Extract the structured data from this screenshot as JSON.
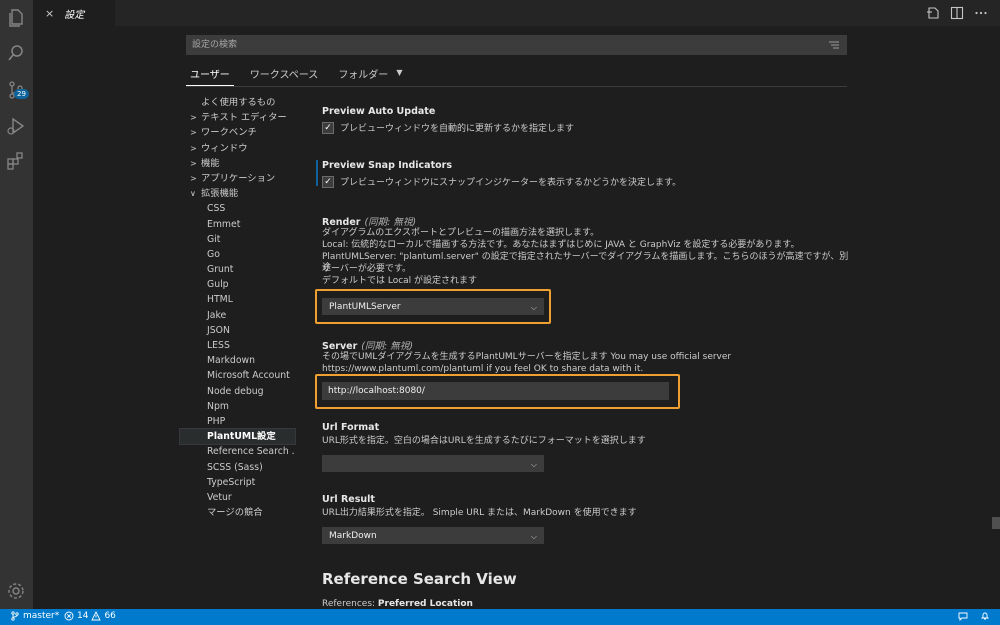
{
  "tab": {
    "title": "設定",
    "close": "×"
  },
  "search": {
    "placeholder": "設定の検索"
  },
  "scope_tabs": [
    "ユーザー",
    "ワークスペース",
    "フォルダー"
  ],
  "activity_badge": "29",
  "toc": [
    {
      "label": "よく使用するもの",
      "chev": ""
    },
    {
      "label": "テキスト エディター",
      "chev": ">"
    },
    {
      "label": "ワークベンチ",
      "chev": ">"
    },
    {
      "label": "ウィンドウ",
      "chev": ">"
    },
    {
      "label": "機能",
      "chev": ">"
    },
    {
      "label": "アプリケーション",
      "chev": ">"
    },
    {
      "label": "拡張機能",
      "chev": "∨"
    },
    {
      "label": "CSS"
    },
    {
      "label": "Emmet"
    },
    {
      "label": "Git"
    },
    {
      "label": "Go"
    },
    {
      "label": "Grunt"
    },
    {
      "label": "Gulp"
    },
    {
      "label": "HTML"
    },
    {
      "label": "Jake"
    },
    {
      "label": "JSON"
    },
    {
      "label": "LESS"
    },
    {
      "label": "Markdown"
    },
    {
      "label": "Microsoft Account"
    },
    {
      "label": "Node debug"
    },
    {
      "label": "Npm"
    },
    {
      "label": "PHP"
    },
    {
      "label": "PlantUML設定"
    },
    {
      "label": "Reference Search ..."
    },
    {
      "label": "SCSS (Sass)"
    },
    {
      "label": "TypeScript"
    },
    {
      "label": "Vetur"
    },
    {
      "label": "マージの競合"
    }
  ],
  "settings": {
    "preview_auto_update": {
      "title": "Preview Auto Update",
      "desc": "プレビューウィンドウを自動的に更新するかを指定します",
      "checked": "✓"
    },
    "preview_snap": {
      "title": "Preview Snap Indicators",
      "desc": "プレビューウィンドウにスナップインジケーターを表示するかどうかを決定します。",
      "checked": "✓"
    },
    "render": {
      "title": "Render",
      "sync": "(同期: 無視)",
      "desc1": "ダイアグラムのエクスポートとプレビューの描画方法を選択します。",
      "desc2": "Local: 伝統的なローカルで描画する方法です。あなたはまずはじめに JAVA と GraphViz を設定する必要があります。",
      "desc3": "PlantUMLServer: \"plantuml.server\" の設定で指定されたサーバーでダイアグラムを描画します。こちらのほうが高速ですが、別途",
      "desc4": "サーバーが必要です。",
      "desc5": "デフォルトでは Local が設定されます",
      "value": "PlantUMLServer"
    },
    "server": {
      "title": "Server",
      "sync": "(同期: 無視)",
      "desc1": "その場でUMLダイアグラムを生成するPlantUMLサーバーを指定します You may use official server",
      "desc2": "https://www.plantuml.com/plantuml if you feel OK to share data with it.",
      "value": "http://localhost:8080/"
    },
    "url_format": {
      "title": "Url Format",
      "desc": "URL形式を指定。空白の場合はURLを生成するたびにフォーマットを選択します",
      "value": ""
    },
    "url_result": {
      "title": "Url Result",
      "desc": "URL出力結果形式を指定。 Simple URL または、MarkDown を使用できます",
      "value": "MarkDown"
    }
  },
  "section": {
    "title": "Reference Search View",
    "ref_prefix": "References: ",
    "ref_name": "Preferred Location"
  },
  "status": {
    "branch": "master*",
    "errors": "14",
    "warnings": "66"
  }
}
